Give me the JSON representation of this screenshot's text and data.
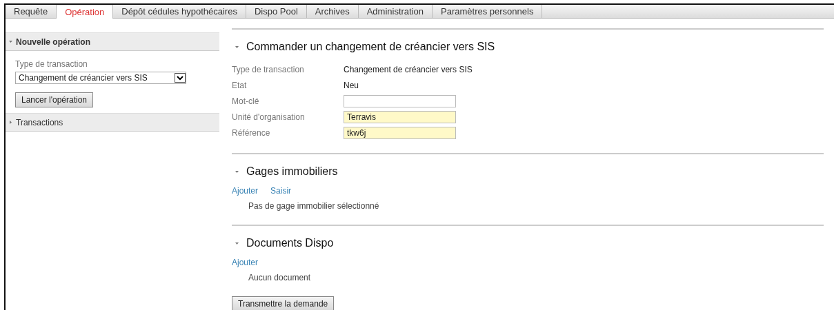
{
  "tabs": [
    {
      "label": "Requête",
      "selected": false
    },
    {
      "label": "Opération",
      "selected": true
    },
    {
      "label": "Dépôt cédules hypothécaires",
      "selected": false
    },
    {
      "label": "Dispo Pool",
      "selected": false
    },
    {
      "label": "Archives",
      "selected": false
    },
    {
      "label": "Administration",
      "selected": false
    },
    {
      "label": "Paramètres personnels",
      "selected": false
    }
  ],
  "sidebar": {
    "panels": [
      {
        "title": "Nouvelle opération",
        "expanded": true,
        "field_label": "Type de transaction",
        "select_value": "Changement de créancier vers SIS",
        "button": "Lancer l'opération"
      },
      {
        "title": "Transactions",
        "expanded": false
      }
    ]
  },
  "main": {
    "title": "Commander un changement de créancier vers SIS",
    "fields": [
      {
        "label": "Type de transaction",
        "kind": "text",
        "value": "Changement de créancier vers SIS"
      },
      {
        "label": "Etat",
        "kind": "text",
        "value": "Neu"
      },
      {
        "label": "Mot-clé",
        "kind": "input",
        "highlighted": false
      },
      {
        "label": "Unité d'organisation",
        "kind": "input",
        "value": "Terravis",
        "highlighted": true
      },
      {
        "label": "Référence",
        "kind": "input",
        "value": "tkw6j",
        "highlighted": true
      }
    ],
    "sections": [
      {
        "title": "Gages immobiliers",
        "links": [
          "Ajouter",
          "Saisir"
        ],
        "empty_text": "Pas de gage immobilier sélectionné"
      },
      {
        "title": "Documents Dispo",
        "links": [
          "Ajouter"
        ],
        "empty_text": "Aucun document"
      }
    ],
    "submit_button": "Transmettre la demande"
  }
}
